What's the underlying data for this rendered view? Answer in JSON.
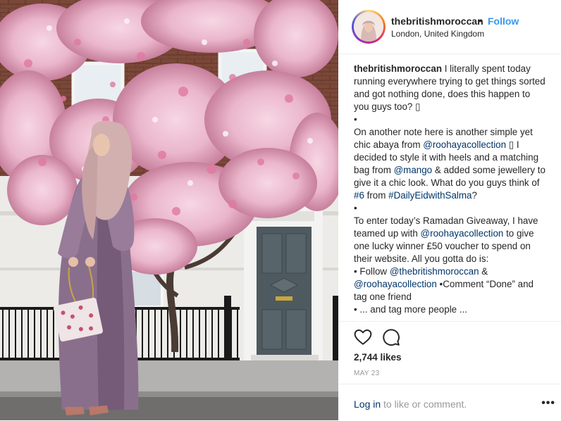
{
  "post": {
    "username": "thebritishmoroccan",
    "separator": "•",
    "follow_label": "Follow",
    "location": "London, United Kingdom",
    "photo_alt": "Woman in lilac abaya and hijab standing in front of a house covered in pink climbing roses"
  },
  "caption": {
    "username": "thebritishmoroccan",
    "line1": " I literally spent today running everywhere trying to get things sorted and got nothing done, does this happen to you guys too? ▯",
    "bullet1": "•",
    "p2_a": "On another note here is another simple yet chic abaya from ",
    "p2_tag1": "@roohayacollection",
    "p2_b": " ▯ I decided to style it with heels and a matching bag from ",
    "p2_tag2": "@mango",
    "p2_c": " & added some jewellery to give it a chic look. What do you guys think of ",
    "p2_tag3": "#6",
    "p2_d": " from ",
    "p2_tag4": "#DailyEidwithSalma",
    "p2_e": "?",
    "bullet2": "•",
    "p3_a": "To enter today’s Ramadan Giveaway, I have teamed up with ",
    "p3_tag1": "@roohayacollection",
    "p3_b": " to give one lucky winner £50 voucher to spend on their website. All you gotta do is:",
    "p4_a": "• Follow ",
    "p4_tag1": "@thebritishmoroccan",
    "p4_b": " & ",
    "p4_tag2": "@roohayacollection",
    "p4_c": " •Comment “Done” and tag one friend",
    "p5": "• ... and tag more people ..."
  },
  "actions": {
    "like_icon": "heart-icon",
    "comment_icon": "comment-icon"
  },
  "likes": "2,744 likes",
  "date": "MAY 23",
  "footer": {
    "login": "Log in",
    "login_suffix": " to like or comment.",
    "more": "•••"
  },
  "colors": {
    "link": "#3897f0",
    "tag": "#003569",
    "muted": "#999999",
    "text": "#262626",
    "border": "#efefef"
  }
}
